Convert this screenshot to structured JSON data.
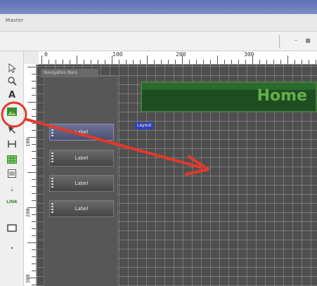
{
  "window": {
    "title": "Master",
    "controls": [
      "–",
      "■"
    ]
  },
  "ruler": {
    "h_labels": [
      "0",
      "100",
      "200",
      "300"
    ],
    "v_labels": [
      "100",
      "200",
      "300"
    ]
  },
  "palette": {
    "tools": [
      {
        "name": "pointer-arrow-icon",
        "glyph": "▷"
      },
      {
        "name": "zoom-icon",
        "glyph": "🔍"
      },
      {
        "name": "text-tool-icon",
        "glyph": "A"
      },
      {
        "name": "image-tool-icon",
        "glyph": ""
      },
      {
        "name": "move-tool-icon",
        "glyph": "↖"
      },
      {
        "name": "frame-tool-icon",
        "glyph": "⊢"
      },
      {
        "name": "grid-tool-icon",
        "glyph": "▦"
      },
      {
        "name": "list-tool-icon",
        "glyph": "☰"
      },
      {
        "name": "hand-tool-icon",
        "glyph": "✋"
      },
      {
        "name": "link-tool-icon",
        "glyph": "LINK"
      },
      {
        "name": "rectangle-tool-icon",
        "glyph": "▭"
      },
      {
        "name": "dot-icon",
        "glyph": "•"
      }
    ]
  },
  "canvas": {
    "panel_title": "Navigation Bars",
    "header_text": "Home",
    "layer_tag": "Layout",
    "buttons": [
      {
        "label": "Label",
        "selected": true
      },
      {
        "label": "Label",
        "selected": false
      },
      {
        "label": "Label",
        "selected": false
      },
      {
        "label": "Label",
        "selected": false
      }
    ]
  },
  "colors": {
    "title_band": "#5d6fb5",
    "canvas_bg": "#4f4f4f",
    "header_bg": "#1f4d22",
    "header_text": "#63b04a",
    "tag_bg": "#2e3fb8",
    "annotation": "#e23a2a"
  }
}
